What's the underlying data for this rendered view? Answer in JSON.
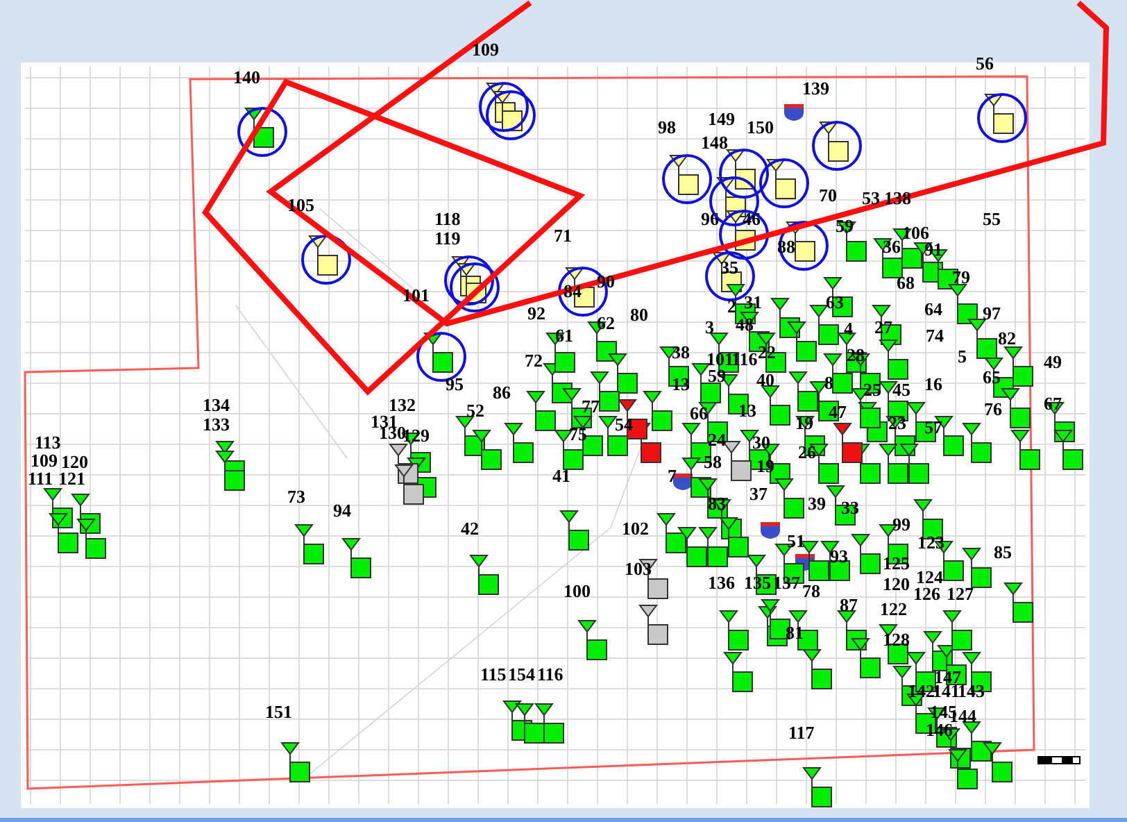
{
  "site_labels": [
    "140",
    "109",
    "105",
    "118",
    "119",
    "101",
    "71",
    "84",
    "90",
    "98",
    "149",
    "148",
    "150",
    "139",
    "70",
    "53",
    "138",
    "96",
    "46",
    "88",
    "35",
    "56",
    "59",
    "36",
    "106",
    "91",
    "55",
    "79",
    "68",
    "64",
    "97",
    "74",
    "82",
    "5",
    "49",
    "65",
    "16",
    "76",
    "67",
    "57",
    "63",
    "4",
    "27",
    "28",
    "25",
    "45",
    "23",
    "2",
    "31",
    "3",
    "48",
    "38",
    "101",
    "116",
    "22",
    "13",
    "59",
    "40",
    "8",
    "80",
    "62",
    "92",
    "61",
    "72",
    "86",
    "95",
    "52",
    "77",
    "75",
    "54",
    "41",
    "66",
    "13",
    "47",
    "19",
    "30",
    "26",
    "24",
    "58",
    "7",
    "19",
    "37",
    "83",
    "39",
    "33",
    "99",
    "123",
    "102",
    "103",
    "100",
    "51",
    "93",
    "136",
    "135",
    "137",
    "78",
    "87",
    "125",
    "120",
    "124",
    "126",
    "127",
    "122",
    "85",
    "81",
    "128",
    "147",
    "142",
    "141",
    "143",
    "145",
    "144",
    "146",
    "117",
    "73",
    "94",
    "42",
    "151",
    "115",
    "154",
    "116",
    "113",
    "109",
    "120",
    "111",
    "121",
    "134",
    "133",
    "132",
    "131",
    "130",
    "129"
  ],
  "sites": [
    {
      "color": "#ffff99",
      "kind": "circled"
    },
    {
      "color": "#ffff99",
      "kind": "circled"
    },
    {
      "color": "#ffff99",
      "kind": "circled"
    },
    {
      "color": "#ffff99",
      "kind": "circled"
    },
    {
      "color": "#ffff99",
      "kind": "circled"
    },
    {
      "color": "#ffff99",
      "kind": "circled"
    },
    {
      "color": "#ffff99",
      "kind": "circled"
    },
    {
      "color": "#ffff99",
      "kind": "circled"
    },
    {
      "color": "#ffff99",
      "kind": "circled"
    },
    {
      "color": "#ffff99",
      "kind": "circled"
    },
    {
      "color": "#ffff99",
      "kind": "circled"
    },
    {
      "color": "#ffff99",
      "kind": "circled"
    },
    {
      "color": "#ffff99",
      "kind": "circled"
    },
    {
      "color": "#ffff99",
      "kind": "circled"
    },
    {
      "color": "#ffff99",
      "kind": "circled"
    },
    {
      "color": "#00ee00",
      "kind": "circled"
    },
    {
      "color": "#00ee00",
      "kind": "circled"
    },
    {
      "color": "#00ee00",
      "kind": "plain"
    },
    {
      "color": "#00ee00",
      "kind": "plain"
    },
    {
      "color": "#00ee00",
      "kind": "plain"
    },
    {
      "color": "#00ee00",
      "kind": "plain"
    },
    {
      "color": "#00ee00",
      "kind": "plain"
    },
    {
      "color": "#00ee00",
      "kind": "plain"
    },
    {
      "color": "#00ee00",
      "kind": "plain"
    },
    {
      "color": "#00ee00",
      "kind": "plain"
    },
    {
      "color": "#00ee00",
      "kind": "plain"
    },
    {
      "color": "#00ee00",
      "kind": "plain"
    },
    {
      "color": "#00ee00",
      "kind": "plain"
    },
    {
      "color": "#00ee00",
      "kind": "plain"
    },
    {
      "color": "#00ee00",
      "kind": "plain"
    },
    {
      "color": "#00ee00",
      "kind": "plain"
    },
    {
      "color": "#00ee00",
      "kind": "plain"
    },
    {
      "color": "#00ee00",
      "kind": "plain"
    },
    {
      "color": "#00ee00",
      "kind": "plain"
    },
    {
      "color": "#00ee00",
      "kind": "plain"
    },
    {
      "color": "#00ee00",
      "kind": "plain"
    },
    {
      "color": "#00ee00",
      "kind": "plain"
    },
    {
      "color": "#00ee00",
      "kind": "plain"
    },
    {
      "color": "#00ee00",
      "kind": "plain"
    },
    {
      "color": "#00ee00",
      "kind": "plain"
    },
    {
      "color": "#00ee00",
      "kind": "plain"
    },
    {
      "color": "#00ee00",
      "kind": "plain"
    },
    {
      "color": "#00ee00",
      "kind": "plain"
    },
    {
      "color": "#00ee00",
      "kind": "plain"
    },
    {
      "color": "#00ee00",
      "kind": "plain"
    },
    {
      "color": "#00ee00",
      "kind": "plain"
    },
    {
      "color": "#00ee00",
      "kind": "plain"
    },
    {
      "color": "#00ee00",
      "kind": "plain"
    },
    {
      "color": "#00ee00",
      "kind": "plain"
    },
    {
      "color": "#00ee00",
      "kind": "plain"
    },
    {
      "color": "#00ee00",
      "kind": "plain"
    },
    {
      "color": "#00ee00",
      "kind": "plain"
    },
    {
      "color": "#00ee00",
      "kind": "plain"
    },
    {
      "color": "#00ee00",
      "kind": "plain"
    },
    {
      "color": "#00ee00",
      "kind": "plain"
    },
    {
      "color": "#00ee00",
      "kind": "plain"
    },
    {
      "color": "#00ee00",
      "kind": "plain"
    },
    {
      "color": "#00ee00",
      "kind": "plain"
    },
    {
      "color": "#00ee00",
      "kind": "plain"
    },
    {
      "color": "#00ee00",
      "kind": "plain"
    },
    {
      "color": "#00ee00",
      "kind": "plain"
    },
    {
      "color": "#00ee00",
      "kind": "plain"
    },
    {
      "color": "#00ee00",
      "kind": "plain"
    },
    {
      "color": "#00ee00",
      "kind": "plain"
    },
    {
      "color": "#00ee00",
      "kind": "plain"
    },
    {
      "color": "#00ee00",
      "kind": "plain"
    },
    {
      "color": "#00ee00",
      "kind": "plain"
    },
    {
      "color": "#00ee00",
      "kind": "plain"
    },
    {
      "color": "#00ee00",
      "kind": "plain"
    },
    {
      "color": "#00ee00",
      "kind": "plain"
    },
    {
      "color": "#00ee00",
      "kind": "plain"
    },
    {
      "color": "#00ee00",
      "kind": "plain"
    },
    {
      "color": "#00ee00",
      "kind": "plain"
    },
    {
      "color": "#00ee00",
      "kind": "plain"
    },
    {
      "color": "#00ee00",
      "kind": "plain"
    },
    {
      "color": "#00ee00",
      "kind": "plain"
    },
    {
      "color": "#00ee00",
      "kind": "plain"
    },
    {
      "color": "#00ee00",
      "kind": "plain"
    },
    {
      "color": "#00ee00",
      "kind": "plain"
    },
    {
      "color": "#00ee00",
      "kind": "plain"
    },
    {
      "color": "#00ee00",
      "kind": "plain"
    },
    {
      "color": "#00ee00",
      "kind": "plain"
    },
    {
      "color": "#00ee00",
      "kind": "plain"
    },
    {
      "color": "#00ee00",
      "kind": "plain"
    },
    {
      "color": "#00ee00",
      "kind": "plain"
    },
    {
      "color": "#00ee00",
      "kind": "plain"
    },
    {
      "color": "#00ee00",
      "kind": "plain"
    },
    {
      "color": "#00ee00",
      "kind": "plain"
    },
    {
      "color": "#00ee00",
      "kind": "plain"
    },
    {
      "color": "#00ee00",
      "kind": "plain"
    },
    {
      "color": "#00ee00",
      "kind": "plain"
    },
    {
      "color": "#00ee00",
      "kind": "plain"
    },
    {
      "color": "#00ee00",
      "kind": "plain"
    },
    {
      "color": "#00ee00",
      "kind": "plain"
    },
    {
      "color": "#00ee00",
      "kind": "plain"
    },
    {
      "color": "#00ee00",
      "kind": "plain"
    },
    {
      "color": "#00ee00",
      "kind": "plain"
    },
    {
      "color": "#00ee00",
      "kind": "plain"
    },
    {
      "color": "#00ee00",
      "kind": "plain"
    },
    {
      "color": "#00ee00",
      "kind": "plain"
    },
    {
      "color": "#00ee00",
      "kind": "plain"
    },
    {
      "color": "#00ee00",
      "kind": "plain"
    },
    {
      "color": "#00ee00",
      "kind": "plain"
    },
    {
      "color": "#00ee00",
      "kind": "plain"
    },
    {
      "color": "#00ee00",
      "kind": "plain"
    },
    {
      "color": "#00ee00",
      "kind": "plain"
    },
    {
      "color": "#00ee00",
      "kind": "plain"
    },
    {
      "color": "#00ee00",
      "kind": "plain"
    },
    {
      "color": "#00ee00",
      "kind": "plain"
    },
    {
      "color": "#00ee00",
      "kind": "plain"
    },
    {
      "color": "#00ee00",
      "kind": "plain"
    },
    {
      "color": "#00ee00",
      "kind": "plain"
    },
    {
      "color": "#00ee00",
      "kind": "plain"
    },
    {
      "color": "#00ee00",
      "kind": "plain"
    },
    {
      "color": "#00ee00",
      "kind": "plain"
    },
    {
      "color": "#00ee00",
      "kind": "plain"
    },
    {
      "color": "#00ee00",
      "kind": "plain"
    },
    {
      "color": "#00ee00",
      "kind": "plain"
    },
    {
      "color": "#00ee00",
      "kind": "plain"
    },
    {
      "color": "#00ee00",
      "kind": "plain"
    },
    {
      "color": "#00ee00",
      "kind": "plain"
    },
    {
      "color": "#00ee00",
      "kind": "plain"
    },
    {
      "color": "#00ee00",
      "kind": "plain"
    },
    {
      "color": "#00ee00",
      "kind": "plain"
    },
    {
      "color": "#00ee00",
      "kind": "plain"
    },
    {
      "color": "#00ee00",
      "kind": "plain"
    },
    {
      "color": "#00ee00",
      "kind": "plain"
    },
    {
      "color": "#00ee00",
      "kind": "plain"
    },
    {
      "color": "#00ee00",
      "kind": "plain"
    },
    {
      "color": "#00ee00",
      "kind": "plain"
    },
    {
      "color": "#00ee00",
      "kind": "plain"
    },
    {
      "color": "#00ee00",
      "kind": "plain"
    },
    {
      "color": "#00ee00",
      "kind": "plain"
    },
    {
      "color": "#00ee00",
      "kind": "plain"
    },
    {
      "color": "#00ee00",
      "kind": "plain"
    },
    {
      "color": "#00ee00",
      "kind": "plain"
    },
    {
      "color": "#00ee00",
      "kind": "plain"
    },
    {
      "color": "#c8c8c8",
      "kind": "plain"
    },
    {
      "color": "#c8c8c8",
      "kind": "plain"
    },
    {
      "color": "#c8c8c8",
      "kind": "plain"
    },
    {
      "color": "#c8c8c8",
      "kind": "plain"
    },
    {
      "color": "#c8c8c8",
      "kind": "plain"
    },
    {
      "color": "#ee1111",
      "kind": "plain"
    },
    {
      "color": "#ee1111",
      "kind": "plain"
    },
    {
      "color": "#ee1111",
      "kind": "plain"
    }
  ]
}
